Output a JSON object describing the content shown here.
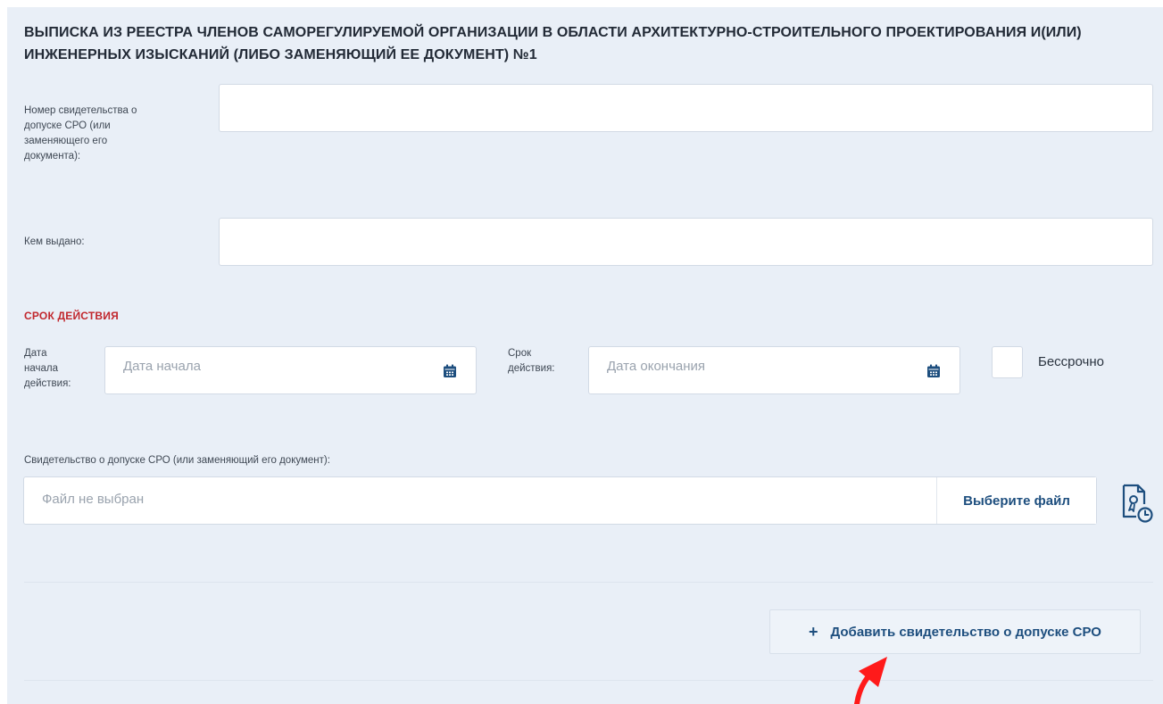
{
  "section": {
    "title": "ВЫПИСКА ИЗ РЕЕСТРА ЧЛЕНОВ САМОРЕГУЛИРУЕМОЙ ОРГАНИЗАЦИИ В ОБЛАСТИ АРХИТЕКТУРНО-СТРОИТЕЛЬНОГО ПРОЕКТИРОВАНИЯ И(ИЛИ) ИНЖЕНЕРНЫХ ИЗЫСКАНИЙ (ЛИБО ЗАМЕНЯЮЩИЙ ЕЕ ДОКУМЕНТ) №1"
  },
  "form": {
    "cert_number": {
      "label_lines": [
        "Номер свидетельства о",
        "допуске СРО (или",
        "заменяющего его",
        "документа):"
      ],
      "value": ""
    },
    "issued_by": {
      "label": "Кем выдано:",
      "value": ""
    },
    "validity": {
      "heading": "СРОК ДЕЙСТВИЯ",
      "start_label_lines": [
        "Дата",
        "начала",
        "действия:"
      ],
      "start_placeholder": "Дата начала",
      "end_label_lines": [
        "Срок",
        "действия:"
      ],
      "end_placeholder": "Дата окончания",
      "indefinite_label": "Бессрочно",
      "indefinite_checked": false
    },
    "file": {
      "label": "Свидетельство о допуске СРО (или заменяющий его документ):",
      "placeholder": "Файл не выбран",
      "button_label": "Выберите файл"
    },
    "add_button": {
      "icon": "+",
      "label": "Добавить свидетельство о допуске СРО"
    }
  },
  "colors": {
    "panel_bg": "#e9eff7",
    "accent_red": "#c1272d",
    "link_blue": "#1d4e7e",
    "arrow_red": "#ff1a1a"
  }
}
